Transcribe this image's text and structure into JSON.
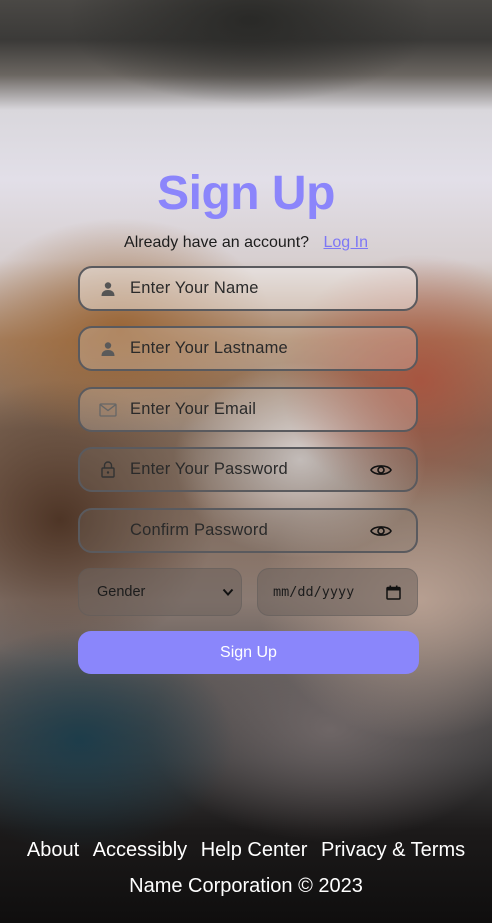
{
  "title": "Sign Up",
  "account_prompt": "Already have an account?",
  "login_link": "Log In",
  "fields": {
    "name": "Enter Your Name",
    "lastname": "Enter Your Lastname",
    "email": "Enter Your Email",
    "password": "Enter Your Password",
    "confirm": "Confirm Password"
  },
  "gender_select": {
    "selected": "Gender"
  },
  "date_input": {
    "value": "mm/dd/yyyy"
  },
  "submit_label": "Sign Up",
  "footer": {
    "links": [
      "About",
      "Accessibly",
      "Help Center",
      "Privacy & Terms"
    ],
    "copyright": "Name Corporation © 2023"
  },
  "colors": {
    "accent": "#8a86fb",
    "title": "#8b85fb",
    "link": "#7d77f5"
  },
  "icons": {
    "name": "user-icon",
    "lastname": "user-icon",
    "email": "mail-icon",
    "password": "lock-icon",
    "reveal": "eye-icon",
    "select": "chevron-down-icon",
    "date": "calendar-icon"
  }
}
